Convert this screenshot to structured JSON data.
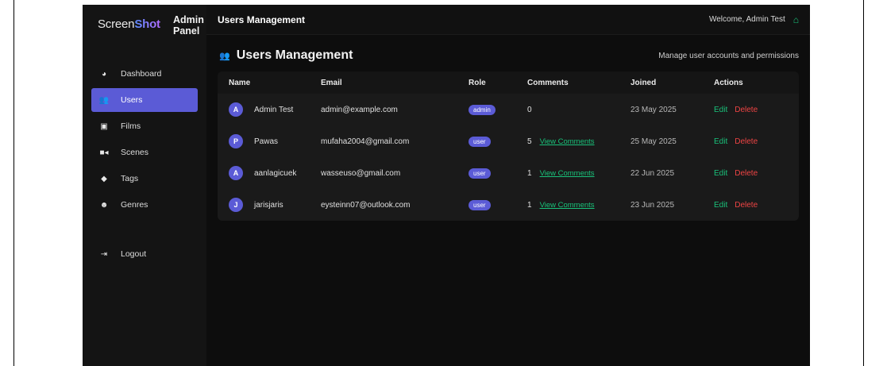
{
  "sidebar": {
    "logo_prefix": "Screen",
    "logo_suffix": "Shot",
    "panel_title_line1": "Admin",
    "panel_title_line2": "Panel",
    "items": [
      {
        "label": "Dashboard",
        "icon": "gauge-icon",
        "active": false
      },
      {
        "label": "Users",
        "icon": "users-icon",
        "active": true
      },
      {
        "label": "Films",
        "icon": "film-icon",
        "active": false
      },
      {
        "label": "Scenes",
        "icon": "video-icon",
        "active": false
      },
      {
        "label": "Tags",
        "icon": "tag-icon",
        "active": false
      },
      {
        "label": "Genres",
        "icon": "masks-icon",
        "active": false
      }
    ],
    "logout": {
      "label": "Logout",
      "icon": "logout-icon"
    }
  },
  "topbar": {
    "title": "Users Management",
    "welcome": "Welcome, Admin Test"
  },
  "page": {
    "heading": "Users Management",
    "subtitle": "Manage user accounts and permissions"
  },
  "table": {
    "headers": [
      "Name",
      "Email",
      "Role",
      "Comments",
      "Joined",
      "Actions"
    ],
    "rows": [
      {
        "initial": "A",
        "name": "Admin Test",
        "email": "admin@example.com",
        "role": "admin",
        "comments": "0",
        "view_comments": "",
        "joined": "23 May 2025",
        "edit": "Edit",
        "delete": "Delete"
      },
      {
        "initial": "P",
        "name": "Pawas",
        "email": "mufaha2004@gmail.com",
        "role": "user",
        "comments": "5",
        "view_comments": "View Comments",
        "joined": "25 May 2025",
        "edit": "Edit",
        "delete": "Delete"
      },
      {
        "initial": "A",
        "name": "aanlagicuek",
        "email": "wasseuso@gmail.com",
        "role": "user",
        "comments": "1",
        "view_comments": "View Comments",
        "joined": "22 Jun 2025",
        "edit": "Edit",
        "delete": "Delete"
      },
      {
        "initial": "J",
        "name": "jarisjaris",
        "email": "eysteinn07@outlook.com",
        "role": "user",
        "comments": "1",
        "view_comments": "View Comments",
        "joined": "23 Jun 2025",
        "edit": "Edit",
        "delete": "Delete"
      }
    ]
  },
  "colors": {
    "accent": "#5b5bd6",
    "success": "#19c27a",
    "danger": "#ef4444",
    "background": "#0d0d0d"
  }
}
